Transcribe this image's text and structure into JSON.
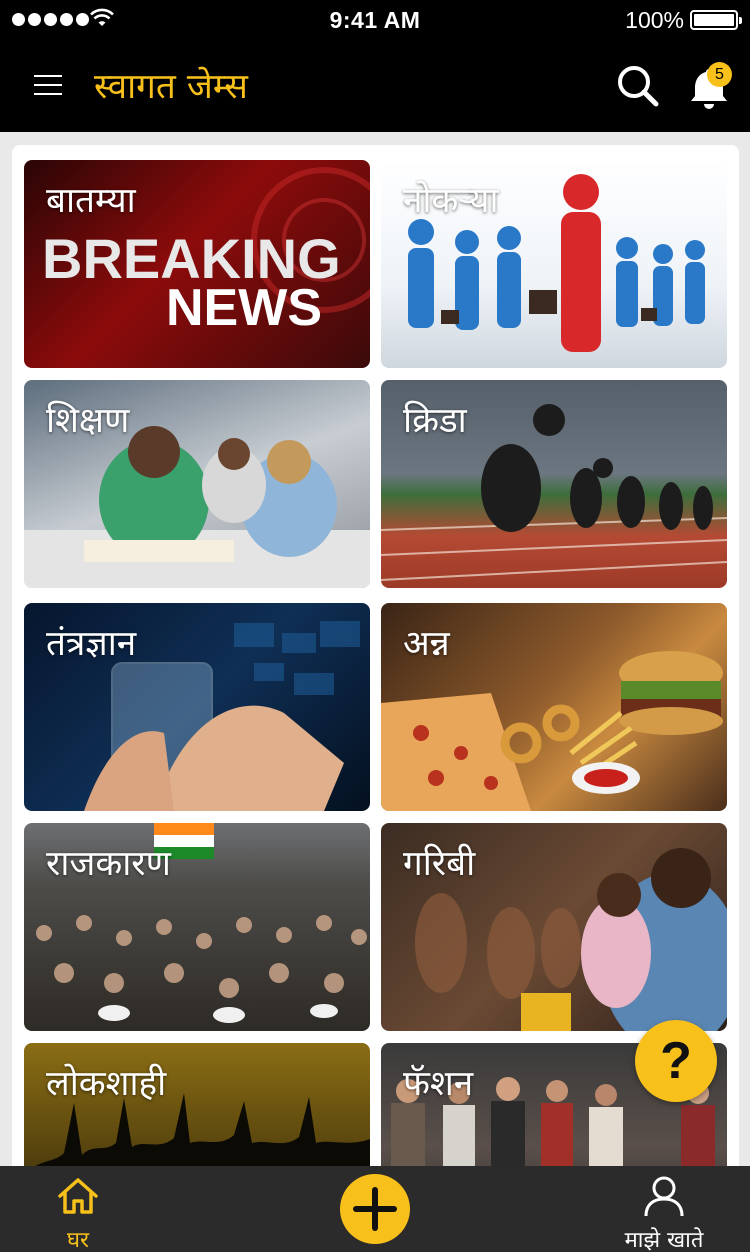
{
  "status_bar": {
    "time": "9:41 AM",
    "battery": "100%"
  },
  "header": {
    "title": "स्वागत जेम्स",
    "notification_count": "5"
  },
  "categories": [
    {
      "label": "बातम्या"
    },
    {
      "label": "नोकऱ्या"
    },
    {
      "label": "शिक्षण"
    },
    {
      "label": "क्रिडा"
    },
    {
      "label": "तंत्रज्ञान"
    },
    {
      "label": "अन्न"
    },
    {
      "label": "राजकारण"
    },
    {
      "label": "गरिबी"
    },
    {
      "label": "लोकशाही"
    },
    {
      "label": "फॅशन"
    }
  ],
  "news_image_text": {
    "line1": "BREAKING",
    "line2": "NEWS"
  },
  "help": {
    "label": "?"
  },
  "tabbar": {
    "home_label": "घर",
    "account_label": "माझे खाते"
  },
  "colors": {
    "accent": "#f8c01a",
    "bar": "#000000",
    "tabbar": "#2b2b2b"
  },
  "icons": {
    "menu": "menu-icon",
    "search": "search-icon",
    "bell": "bell-icon",
    "home": "home-icon",
    "add": "plus-icon",
    "user": "user-icon",
    "help": "help-icon"
  }
}
